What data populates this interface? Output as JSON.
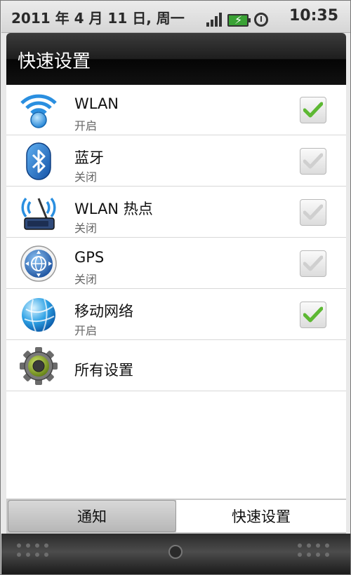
{
  "status_bar": {
    "date": "2011 年 4 月 11 日, 周一",
    "time": "10:35"
  },
  "header": {
    "title": "快速设置"
  },
  "items": [
    {
      "title": "WLAN",
      "subtitle": "开启",
      "checked": true,
      "icon": "wifi-icon"
    },
    {
      "title": "蓝牙",
      "subtitle": "关闭",
      "checked": false,
      "icon": "bluetooth-icon"
    },
    {
      "title": "WLAN 热点",
      "subtitle": "关闭",
      "checked": false,
      "icon": "hotspot-icon"
    },
    {
      "title": "GPS",
      "subtitle": "关闭",
      "checked": false,
      "icon": "gps-icon"
    },
    {
      "title": "移动网络",
      "subtitle": "开启",
      "checked": true,
      "icon": "mobile-network-icon"
    },
    {
      "title": "所有设置",
      "icon": "gear-icon"
    }
  ],
  "tabs": [
    {
      "label": "通知"
    },
    {
      "label": "快速设置"
    }
  ],
  "colors": {
    "check_on": "#5db833",
    "check_off": "#cfcfcf"
  }
}
